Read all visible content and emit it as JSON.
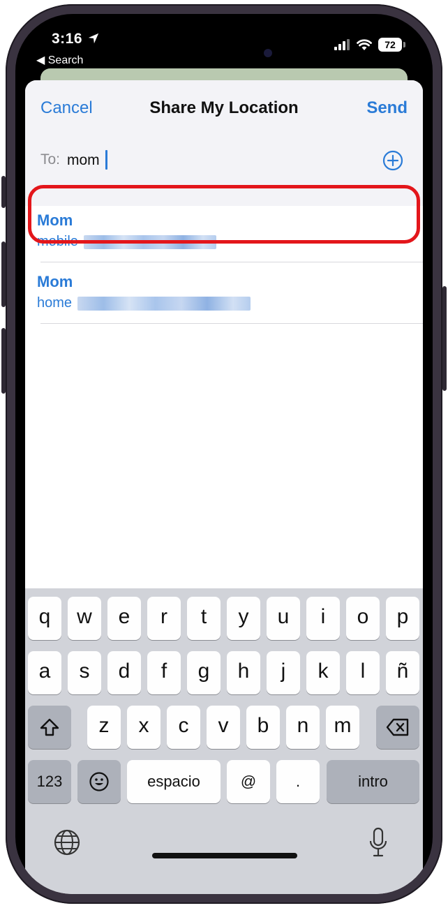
{
  "status_bar": {
    "time": "3:16",
    "back_label": "◀ Search",
    "battery": "72"
  },
  "share_sheet": {
    "cancel_label": "Cancel",
    "title": "Share My Location",
    "send_label": "Send",
    "to_label": "To:",
    "to_value": "mom"
  },
  "results": [
    {
      "name": "Mom",
      "detail_label": "mobile"
    },
    {
      "name": "Mom",
      "detail_label": "home"
    }
  ],
  "keyboard": {
    "row1": [
      "q",
      "w",
      "e",
      "r",
      "t",
      "y",
      "u",
      "i",
      "o",
      "p"
    ],
    "row2": [
      "a",
      "s",
      "d",
      "f",
      "g",
      "h",
      "j",
      "k",
      "l",
      "ñ"
    ],
    "row3": [
      "z",
      "x",
      "c",
      "v",
      "b",
      "n",
      "m"
    ],
    "numbers_label": "123",
    "space_label": "espacio",
    "at_label": "@",
    "period_label": ".",
    "return_label": "intro"
  },
  "icons": {
    "location": "location-arrow-icon",
    "signal": "cellular-signal-icon",
    "wifi": "wifi-icon",
    "battery": "battery-icon",
    "add": "add-contact-icon",
    "shift": "shift-icon",
    "delete": "backspace-icon",
    "emoji": "emoji-icon",
    "globe": "globe-icon",
    "mic": "microphone-icon"
  },
  "colors": {
    "accent": "#2a7bd7",
    "highlight": "#e3161b",
    "keyboard_bg": "#d1d3d9"
  }
}
